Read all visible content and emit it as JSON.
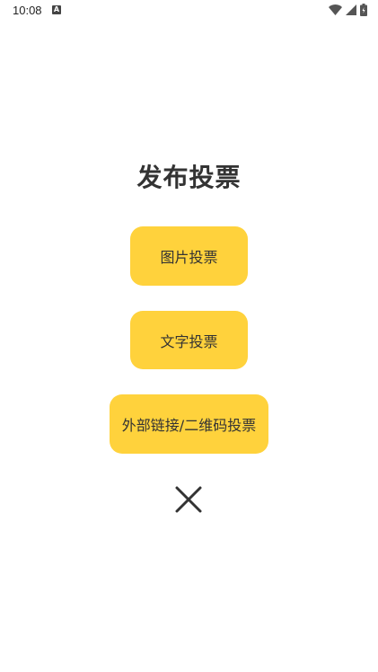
{
  "status_bar": {
    "time": "10:08",
    "left_icon": "a-icon",
    "right_icons": [
      "wifi-icon",
      "signal-icon",
      "battery-icon"
    ]
  },
  "main": {
    "title": "发布投票",
    "buttons": {
      "image_vote": "图片投票",
      "text_vote": "文字投票",
      "link_qr_vote": "外部链接/二维码投票"
    },
    "close_icon": "close-icon"
  },
  "colors": {
    "accent": "#ffd23c",
    "text": "#333333",
    "background": "#ffffff"
  }
}
